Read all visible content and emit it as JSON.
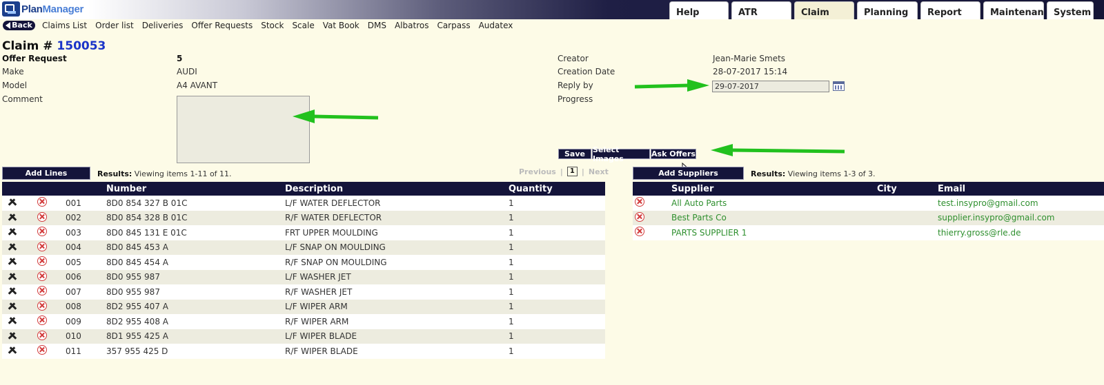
{
  "header": {
    "logo_text_a": "Plan",
    "logo_text_b": "Manager",
    "tabs": [
      "Help",
      "ATR",
      "Claim",
      "Planning",
      "Report",
      "Maintenance",
      "System"
    ],
    "active_tab": "Claim"
  },
  "menu": {
    "back_label": "Back",
    "items": [
      "Claims List",
      "Order list",
      "Deliveries",
      "Offer Requests",
      "Stock",
      "Scale",
      "Vat Book",
      "DMS",
      "Albatros",
      "Carpass",
      "Audatex"
    ]
  },
  "claim": {
    "title_prefix": "Claim #",
    "number": "150053",
    "left_fields": [
      {
        "label": "Offer Request",
        "value": "5"
      },
      {
        "label": "Make",
        "value": "AUDI"
      },
      {
        "label": "Model",
        "value": "A4 AVANT"
      },
      {
        "label": "Comment",
        "value": ""
      }
    ],
    "right_fields": [
      {
        "label": "Creator",
        "value": "Jean-Marie Smets"
      },
      {
        "label": "Creation Date",
        "value": "28-07-2017 15:14"
      },
      {
        "label": "Reply by",
        "value": "29-07-2017"
      },
      {
        "label": "Progress",
        "value": ""
      }
    ]
  },
  "actions": {
    "save": "Save",
    "select_images": "Select Images",
    "ask_offers": "Ask Offers"
  },
  "lines": {
    "add_button": "Add Lines",
    "results_label": "Results:",
    "results_text": "Viewing items 1-11 of 11.",
    "pager": {
      "previous": "Previous",
      "sep": "|",
      "page": "1",
      "next": "Next"
    },
    "columns": [
      "Number",
      "Description",
      "Quantity"
    ],
    "rows": [
      {
        "idx": "001",
        "number": "8D0 854 327 B 01C",
        "description": "L/F WATER DEFLECTOR",
        "quantity": "1"
      },
      {
        "idx": "002",
        "number": "8D0 854 328 B 01C",
        "description": "R/F WATER DEFLECTOR",
        "quantity": "1"
      },
      {
        "idx": "003",
        "number": "8D0 845 131 E 01C",
        "description": "FRT UPPER MOULDING",
        "quantity": "1"
      },
      {
        "idx": "004",
        "number": "8D0 845 453 A",
        "description": "L/F SNAP ON MOULDING",
        "quantity": "1"
      },
      {
        "idx": "005",
        "number": "8D0 845 454 A",
        "description": "R/F SNAP ON MOULDING",
        "quantity": "1"
      },
      {
        "idx": "006",
        "number": "8D0 955 987",
        "description": "L/F WASHER JET",
        "quantity": "1"
      },
      {
        "idx": "007",
        "number": "8D0 955 987",
        "description": "R/F WASHER JET",
        "quantity": "1"
      },
      {
        "idx": "008",
        "number": "8D2 955 407 A",
        "description": "L/F WIPER ARM",
        "quantity": "1"
      },
      {
        "idx": "009",
        "number": "8D2 955 408 A",
        "description": "R/F WIPER ARM",
        "quantity": "1"
      },
      {
        "idx": "010",
        "number": "8D1 955 425 A",
        "description": "L/F WIPER BLADE",
        "quantity": "1"
      },
      {
        "idx": "011",
        "number": "357 955 425 D",
        "description": "R/F WIPER BLADE",
        "quantity": "1"
      }
    ]
  },
  "suppliers": {
    "add_button": "Add Suppliers",
    "results_label": "Results:",
    "results_text": "Viewing items 1-3 of 3.",
    "columns": [
      "Supplier",
      "City",
      "Email"
    ],
    "rows": [
      {
        "supplier": "All Auto Parts",
        "city": "",
        "email": "test.insypro@gmail.com"
      },
      {
        "supplier": "Best Parts Co",
        "city": "",
        "email": "supplier.insypro@gmail.com"
      },
      {
        "supplier": "PARTS SUPPLIER 1",
        "city": "",
        "email": "thierry.gross@rle.de"
      }
    ]
  },
  "colors": {
    "navy": "#14143a",
    "link_blue": "#1a34c8",
    "supplier_green": "#2e8f2e",
    "arrow_green": "#22c11e",
    "background": "#fdfbe7"
  }
}
